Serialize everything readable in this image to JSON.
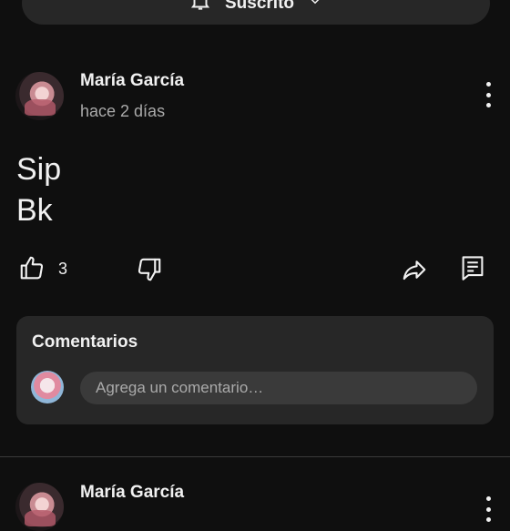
{
  "subscribe": {
    "label": "Suscrito"
  },
  "post": {
    "author": "María García",
    "time": "hace 2 días",
    "body_lines": [
      "Sip",
      "Bk"
    ],
    "like_count": "3"
  },
  "comments": {
    "title": "Comentarios",
    "placeholder": "Agrega un comentario…"
  },
  "next_post": {
    "author": "María García"
  },
  "icons": [
    "bell-icon",
    "chevron-down-icon",
    "more-vert-icon",
    "thumb-up-icon",
    "thumb-down-icon",
    "share-icon",
    "comment-icon"
  ]
}
